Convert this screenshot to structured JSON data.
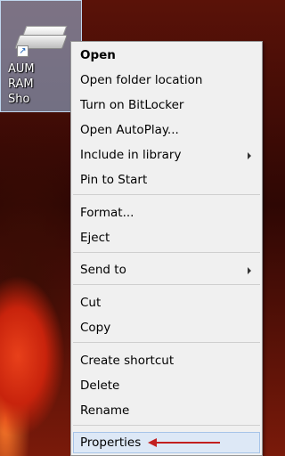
{
  "desktop_icon": {
    "label": "AUM\nRAM\nSho"
  },
  "context_menu": {
    "items": [
      {
        "label": "Open"
      },
      {
        "label": "Open folder location"
      },
      {
        "label": "Turn on BitLocker"
      },
      {
        "label": "Open AutoPlay..."
      },
      {
        "label": "Include in library"
      },
      {
        "label": "Pin to Start"
      },
      {
        "label": "Format..."
      },
      {
        "label": "Eject"
      },
      {
        "label": "Send to"
      },
      {
        "label": "Cut"
      },
      {
        "label": "Copy"
      },
      {
        "label": "Create shortcut"
      },
      {
        "label": "Delete"
      },
      {
        "label": "Rename"
      },
      {
        "label": "Properties"
      }
    ]
  },
  "annotation": {
    "arrow_color": "#c21f1f",
    "points_to": "Properties"
  },
  "colors": {
    "menu_bg": "#f0f0f0",
    "highlight_bg": "#dde8f6",
    "highlight_border": "#a7c4e8",
    "selection_bg": "#9bc3eb"
  }
}
